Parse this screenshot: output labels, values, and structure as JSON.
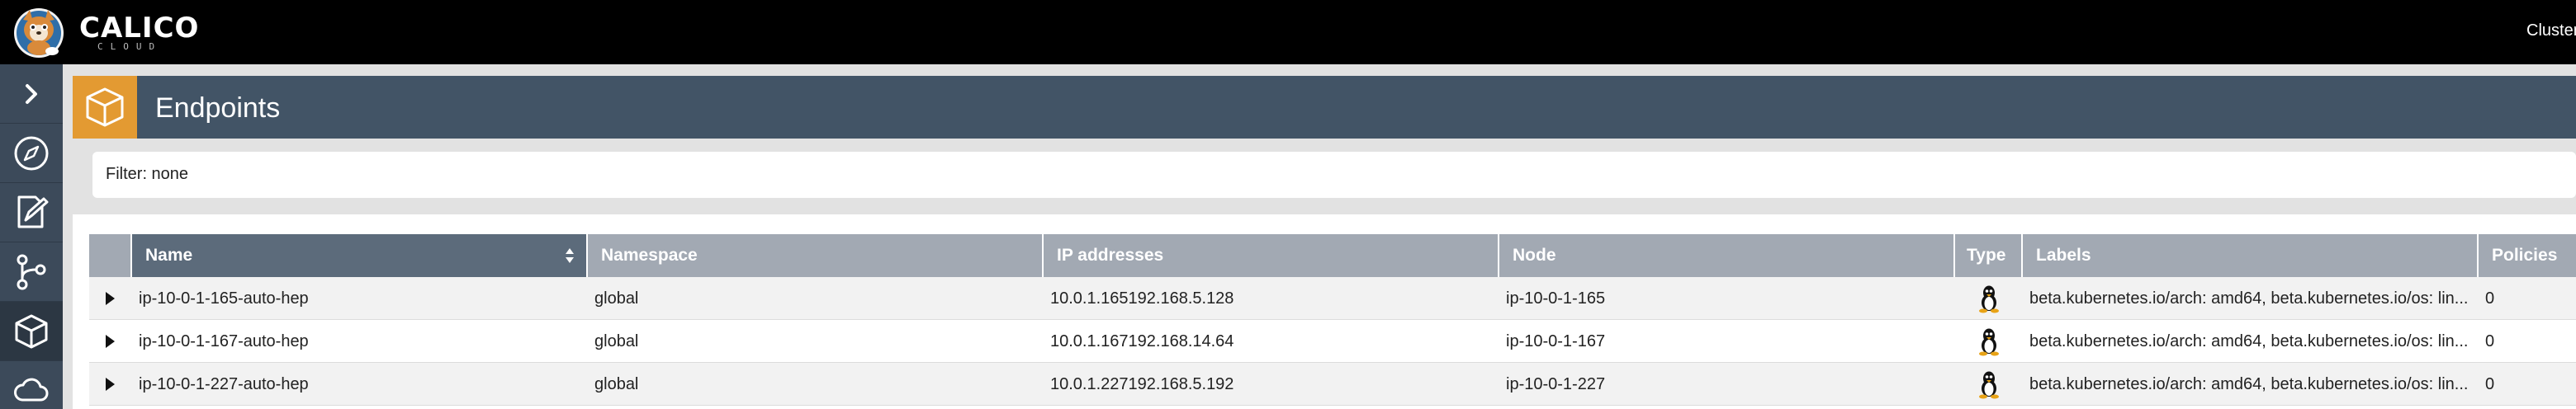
{
  "app": {
    "logo_word": "CALICO",
    "logo_sub": "CLOUD",
    "cluster_label": "Cluster"
  },
  "sidebar": {
    "items": [
      {
        "name": "expand",
        "icon": "chevron-right-icon"
      },
      {
        "name": "dashboard",
        "icon": "compass-icon"
      },
      {
        "name": "policies",
        "icon": "edit-document-icon"
      },
      {
        "name": "service-graph",
        "icon": "graph-icon"
      },
      {
        "name": "endpoints",
        "icon": "cube-icon",
        "active": true
      },
      {
        "name": "managed-clusters",
        "icon": "cloud-icon"
      }
    ]
  },
  "page": {
    "title": "Endpoints",
    "filter_text": "Filter: none"
  },
  "table": {
    "columns": [
      "Name",
      "Namespace",
      "IP addresses",
      "Node",
      "Type",
      "Labels",
      "Policies"
    ],
    "sorted_column": "Name",
    "rows": [
      {
        "name": "ip-10-0-1-165-auto-hep",
        "namespace": "global",
        "ip_addresses": "10.0.1.165192.168.5.128",
        "node": "ip-10-0-1-165",
        "type_icon": "linux-icon",
        "labels": "beta.kubernetes.io/arch: amd64, beta.kubernetes.io/os: lin...",
        "policies": "0"
      },
      {
        "name": "ip-10-0-1-167-auto-hep",
        "namespace": "global",
        "ip_addresses": "10.0.1.167192.168.14.64",
        "node": "ip-10-0-1-167",
        "type_icon": "linux-icon",
        "labels": "beta.kubernetes.io/arch: amd64, beta.kubernetes.io/os: lin...",
        "policies": "0"
      },
      {
        "name": "ip-10-0-1-227-auto-hep",
        "namespace": "global",
        "ip_addresses": "10.0.1.227192.168.5.192",
        "node": "ip-10-0-1-227",
        "type_icon": "linux-icon",
        "labels": "beta.kubernetes.io/arch: amd64, beta.kubernetes.io/os: lin...",
        "policies": "0"
      }
    ]
  },
  "colors": {
    "accent": "#e39a32",
    "header": "#425466",
    "sidebar": "#3c4a5a",
    "table_header": "#a2a9b3",
    "table_header_sorted": "#5c6b7b"
  }
}
